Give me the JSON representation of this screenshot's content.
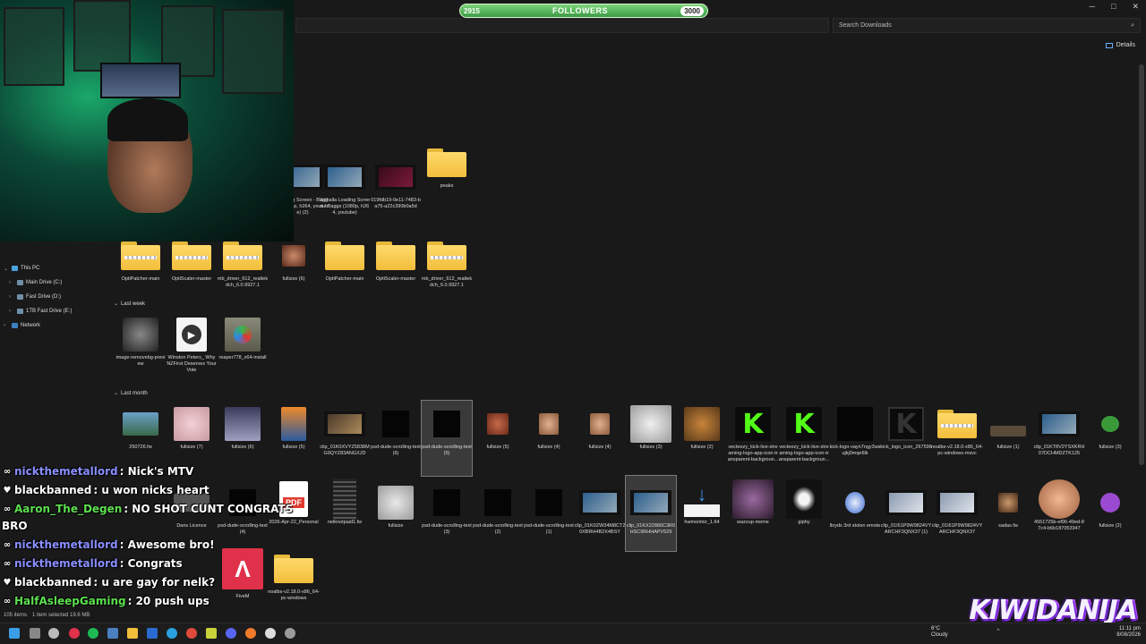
{
  "followers": {
    "current": "2915",
    "label": "FOLLOWERS",
    "goal": "3000"
  },
  "search": {
    "placeholder": "Search Downloads"
  },
  "details_label": "Details",
  "nav": {
    "this_pc": "This PC",
    "drives": [
      "Main Drive (C:)",
      "Fast Drive (D:)",
      "1TB Fast Drive (E:)"
    ],
    "network": "Network"
  },
  "groups": {
    "last_week": "Last week",
    "last_month": "Last month"
  },
  "files": {
    "row0": [
      "Loading Screen - Baggs (1080p, h264, youtube) (2)",
      "Valhalla Loading Screen - Baggs (1080p, h264, youtube)",
      "019fdb19-0e11-7483-ba75-a22c390b0a5d",
      "peaks"
    ],
    "row1": [
      "OptiPatcher-main",
      "OptiScaler-master",
      "mb_driver_612_realtekdch_6.0.9927.1",
      "fullsize (6)",
      "OptiPatcher-main",
      "OptiScaler-master",
      "mb_driver_612_realtekdch_6.0.9927.1"
    ],
    "last_week": [
      "image-removebg-preview",
      "Winston Peters_ Why NZFirst Deserves Your Vote",
      "reaper778_x64-install"
    ],
    "last_month_1": [
      "250726.fw",
      "fullsize (7)",
      "fullsize (6)",
      "fullsize (5)",
      "clip_01K0XVYZ5838MG9QYZ83ANGXJD",
      "psd-dude-scrolling-text (6)",
      "psd-dude-scrolling-text (5)",
      "fullsize (5)",
      "fullsize (4)",
      "fullsize (4)",
      "fullsize (3)",
      "fullsize (2)",
      "vecteezy_kick-live-streaming-logo-app-icon-transparent-backgroun...",
      "vecteezy_kick-live-streaming-logo-app-icon-transparent-backgroun...",
      "kick-logo-vayn7ngy3wsujkj0mqe6lk",
      "kick_logo_icon_267596",
      "noalbs-v2.18.0-x86_64-pc-windows-msvc",
      "fullsize (1)",
      "clip_01KT8V2YSXKRH07DCHMDZTK125",
      "fullsize (3)"
    ],
    "last_month_2": [
      "Dans Licence",
      "psd-dude-scrolling-text (4)",
      "2026-Apr-22_Personal",
      "nelknotpaid1.fw",
      "fullsize",
      "psd-dude-scrolling-text (3)",
      "psd-dude-scrolling-text (2)",
      "psd-dude-scrolling-text (1)",
      "clip_01K0ZW34M8CT20XBRH4B2X4BSY",
      "clip_01KX22886C3R0HSC9RHHAPV529",
      "hwmonitor_1.64",
      "wazzup-meme",
      "giphy",
      "lloyds 3rd stolen emote",
      "clip_01I61P9W9824VYARCHF3QNX37 (1)",
      "clip_01I61P9W9824VYARCHF3QNX37",
      "sadas.fw",
      "4551725b-ef96-49ed-87c4-b6b187053347",
      "fullsize (2)"
    ],
    "last_month_3": [
      "FiveM",
      "noalbs-v2.18.0-x86_64-pc-windows"
    ]
  },
  "pdf_badge": "PDF",
  "chat": [
    {
      "badges": "∞",
      "user": "nickthemetallord",
      "color": "#8a8fff",
      "msg": " : Nick's MTV"
    },
    {
      "badges": "♥",
      "user": "blackbanned",
      "color": "#ffffff",
      "msg": " : u won nicks heart"
    },
    {
      "badges": "∞",
      "user": "Aaron_The_Degen",
      "color": "#5de04f",
      "msg": " : NO SHOT CUNT CONGRATS"
    },
    {
      "badges": "",
      "user": "",
      "color": "#ffffff",
      "msg": "BRO"
    },
    {
      "badges": "∞",
      "user": "nickthemetallord",
      "color": "#8a8fff",
      "msg": " : Awesome bro!"
    },
    {
      "badges": "∞",
      "user": "nickthemetallord",
      "color": "#8a8fff",
      "msg": " : Congrats"
    },
    {
      "badges": "♥",
      "user": "blackbanned",
      "color": "#ffffff",
      "msg": " : u are gay for nelk?"
    },
    {
      "badges": "∞",
      "user": "HalfAsleepGaming",
      "color": "#5de04f",
      "msg": " : 20 push ups"
    }
  ],
  "status": {
    "items": "105 items",
    "selected": "1 item selected  19.6 MB"
  },
  "logo_text": "KIWIDANIJA",
  "weather": {
    "temp": "6°C",
    "cond": "Cloudy"
  },
  "clock": {
    "time": "11:11 pm",
    "date": "8/08/2026"
  },
  "colors": {
    "folder": "#f2be3c",
    "accent": "#53fc18",
    "bar": "#4caf50"
  }
}
